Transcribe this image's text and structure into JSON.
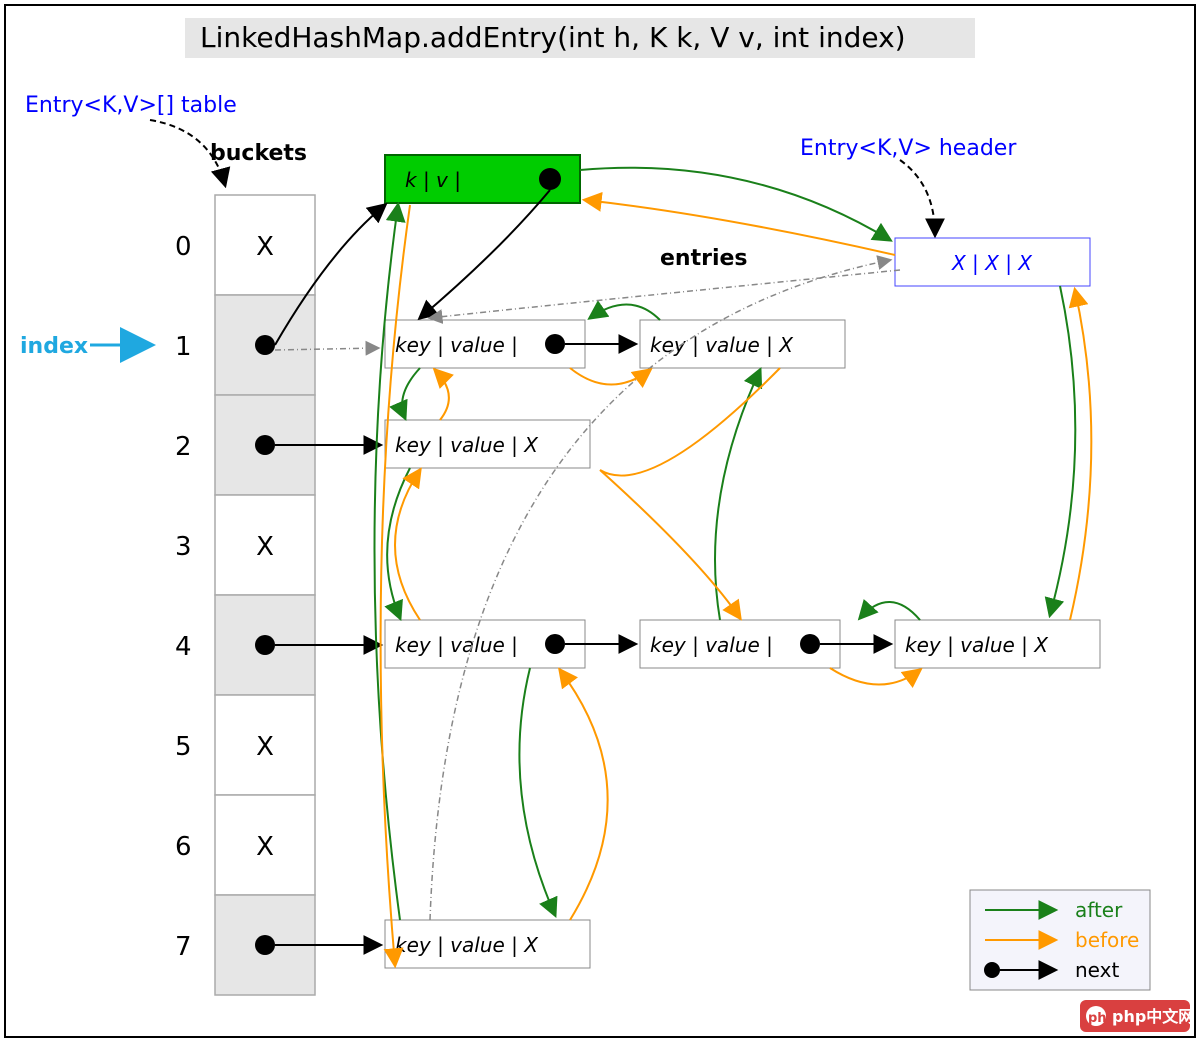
{
  "title": "LinkedHashMap.addEntry(int h, K k, V v, int index)",
  "labels": {
    "table": "Entry<K,V>[] table",
    "buckets": "buckets",
    "header": "Entry<K,V> header",
    "entries": "entries",
    "index": "index"
  },
  "buckets": [
    {
      "i": "0",
      "content": "X"
    },
    {
      "i": "1",
      "content": "dot"
    },
    {
      "i": "2",
      "content": "dot"
    },
    {
      "i": "3",
      "content": "X"
    },
    {
      "i": "4",
      "content": "dot"
    },
    {
      "i": "5",
      "content": "X"
    },
    {
      "i": "6",
      "content": "X"
    },
    {
      "i": "7",
      "content": "dot"
    }
  ],
  "entry_label": "key | value | ",
  "entry_label_end": "key | value |  X",
  "new_entry_label": "k  |  v  | ",
  "header_label": "X   |   X   |  X",
  "legend": {
    "after": "after",
    "before": "before",
    "next": "next"
  },
  "watermark": "php中文网",
  "chart_data": {
    "type": "diagram",
    "description": "LinkedHashMap internal structure showing bucket array (indices 0-7), hash-chain 'next' pointers (black), doubly-linked-list 'after' (green) and 'before' (orange) pointers, a header sentinel node, and a newly inserted green entry at bucket index 1.",
    "bucket_count": 8,
    "occupied_buckets": [
      1,
      2,
      4,
      7
    ],
    "chains": {
      "1": 2,
      "2": 1,
      "4": 3,
      "7": 1
    },
    "insertion_index": 1
  }
}
